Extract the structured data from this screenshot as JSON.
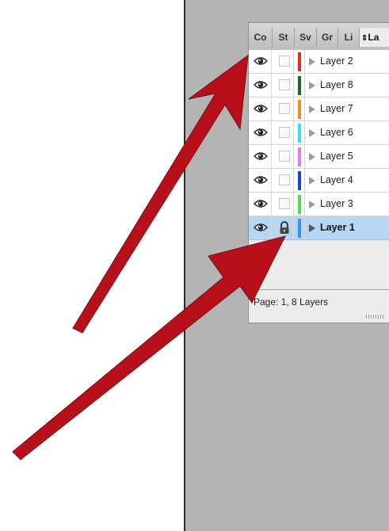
{
  "panel": {
    "tabs": [
      {
        "label": "Co"
      },
      {
        "label": "St"
      },
      {
        "label": "Sv"
      },
      {
        "label": "Gr"
      },
      {
        "label": "Li"
      },
      {
        "label": "La",
        "active": true,
        "prefix_icon": "updown-arrows-icon"
      }
    ],
    "layers": [
      {
        "name": "Layer 2",
        "color": "#e8291f",
        "visible": true,
        "locked": false,
        "selected": false
      },
      {
        "name": "Layer 8",
        "color": "#1f6b1f",
        "visible": true,
        "locked": false,
        "selected": false
      },
      {
        "name": "Layer 7",
        "color": "#f28a26",
        "visible": true,
        "locked": false,
        "selected": false
      },
      {
        "name": "Layer 6",
        "color": "#2ee0f0",
        "visible": true,
        "locked": false,
        "selected": false
      },
      {
        "name": "Layer 5",
        "color": "#e87ae8",
        "visible": true,
        "locked": false,
        "selected": false
      },
      {
        "name": "Layer 4",
        "color": "#1a3fe0",
        "visible": true,
        "locked": false,
        "selected": false
      },
      {
        "name": "Layer 3",
        "color": "#4ce04c",
        "visible": true,
        "locked": false,
        "selected": false
      },
      {
        "name": "Layer 1",
        "color": "#3c8ef0",
        "visible": true,
        "locked": true,
        "selected": true
      }
    ],
    "status": "Page: 1, 8 Layers"
  },
  "colors": {
    "annotation_arrow": "#b8101a",
    "workspace": "#b4b4b4",
    "selection": "#b7d6f5"
  }
}
